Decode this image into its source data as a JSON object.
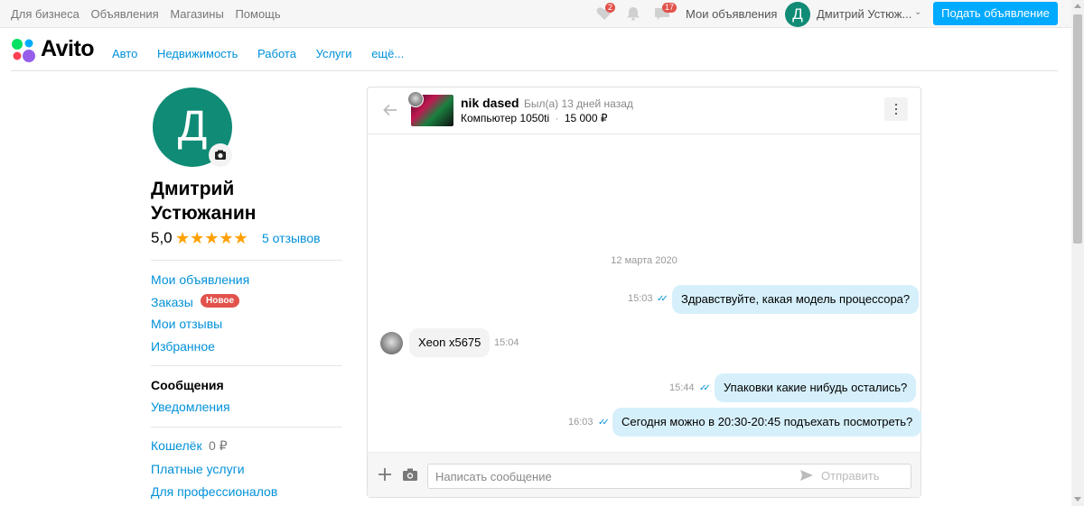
{
  "topbar": {
    "links": [
      "Для бизнеса",
      "Объявления",
      "Магазины",
      "Помощь"
    ],
    "favorites_count": "2",
    "messages_count": "17",
    "my_ads": "Мои объявления",
    "avatar_letter": "Д",
    "username": "Дмитрий Устюж...",
    "post_ad": "Подать объявление"
  },
  "header": {
    "logo": "Avito",
    "nav": [
      "Авто",
      "Недвижимость",
      "Работа",
      "Услуги",
      "ещё..."
    ]
  },
  "profile": {
    "avatar_letter": "Д",
    "name_line1": "Дмитрий",
    "name_line2": "Устюжанин",
    "rating": "5,0",
    "stars": "★★★★★",
    "reviews": "5 отзывов"
  },
  "sidebar": {
    "group1": [
      "Мои объявления",
      "Заказы",
      "Мои отзывы",
      "Избранное"
    ],
    "new_badge": "Новое",
    "messages_title": "Сообщения",
    "notifications": "Уведомления",
    "wallet": "Кошелёк",
    "wallet_amount": "0 ₽",
    "paid_services": "Платные услуги",
    "for_pros": "Для профессионалов"
  },
  "chat": {
    "peer_name": "nik dased",
    "peer_status": "Был(а) 13 дней назад",
    "item_title": "Компьютер 1050ti",
    "item_sep": "·",
    "item_price": "15 000 ₽",
    "date": "12 марта 2020",
    "messages": [
      {
        "dir": "out",
        "text": "Здравствуйте, какая модель процессора?",
        "time": "15:03"
      },
      {
        "dir": "in",
        "text": "Xeon x5675",
        "time": "15:04"
      },
      {
        "dir": "out",
        "text": "Упаковки какие нибудь остались?",
        "time": "15:44"
      },
      {
        "dir": "out",
        "text": "Сегодня можно в 20:30-20:45 подъехать посмотреть?",
        "time": "16:03"
      }
    ],
    "input_placeholder": "Написать сообщение",
    "send_label": "Отправить"
  },
  "colors": {
    "accent_link": "#0091d9",
    "post_button": "#00aaff",
    "avatar": "#0f8b76",
    "badge": "#e2524b",
    "star": "#ffa000",
    "bubble_out": "#d6f0fb"
  }
}
